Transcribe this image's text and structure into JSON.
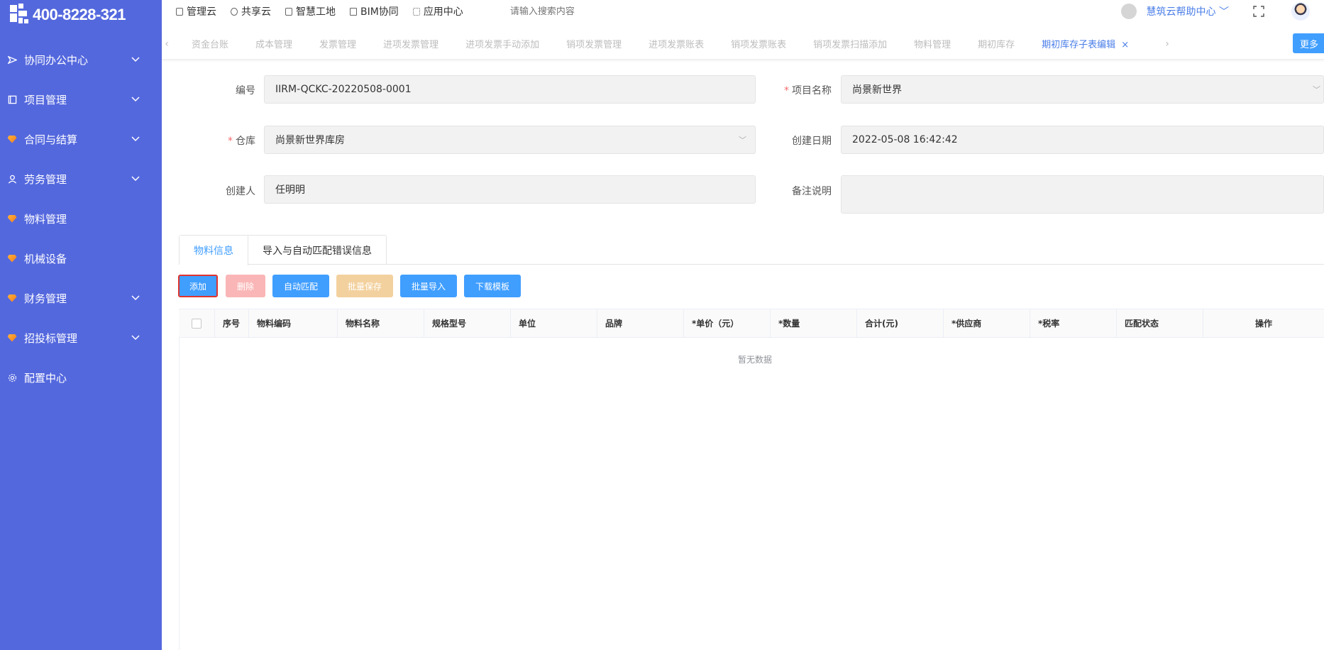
{
  "brand": {
    "phone": "400-8228-321"
  },
  "sidebar": {
    "items": [
      {
        "label": "协同办公中心",
        "icon": "send-icon",
        "chevron": true
      },
      {
        "label": "项目管理",
        "icon": "book-icon",
        "chevron": true
      },
      {
        "label": "合同与结算",
        "icon": "gem-icon",
        "chevron": true
      },
      {
        "label": "劳务管理",
        "icon": "user-icon",
        "chevron": true
      },
      {
        "label": "物料管理",
        "icon": "gem-icon",
        "chevron": false
      },
      {
        "label": "机械设备",
        "icon": "gem-icon",
        "chevron": false
      },
      {
        "label": "财务管理",
        "icon": "gem-icon",
        "chevron": true
      },
      {
        "label": "招投标管理",
        "icon": "gem-icon",
        "chevron": true
      },
      {
        "label": "配置中心",
        "icon": "gear-icon",
        "chevron": false
      }
    ]
  },
  "topbar": {
    "links": [
      "管理云",
      "共享云",
      "智慧工地",
      "BIM协同",
      "应用中心"
    ],
    "search_placeholder": "请输入搜索内容",
    "help": "慧筑云帮助中心"
  },
  "tabs": {
    "items": [
      "资金台账",
      "成本管理",
      "发票管理",
      "进项发票管理",
      "进项发票手动添加",
      "销项发票管理",
      "进项发票账表",
      "销项发票账表",
      "销项发票扫描添加",
      "物料管理",
      "期初库存"
    ],
    "active": "期初库存子表编辑",
    "more": "更多"
  },
  "form": {
    "code_label": "编号",
    "code_value": "IIRM-QCKC-20220508-0001",
    "project_label": "项目名称",
    "project_value": "尚景新世界",
    "warehouse_label": "仓库",
    "warehouse_value": "尚景新世界库房",
    "date_label": "创建日期",
    "date_value": "2022-05-08 16:42:42",
    "creator_label": "创建人",
    "creator_value": "任明明",
    "remark_label": "备注说明",
    "remark_value": ""
  },
  "subtabs": [
    "物料信息",
    "导入与自动匹配错误信息"
  ],
  "buttons": {
    "add": "添加",
    "delete": "删除",
    "auto_match": "自动匹配",
    "batch_save": "批量保存",
    "batch_import": "批量导入",
    "download": "下载模板"
  },
  "colors": {
    "primary": "#409eff",
    "danger_disabled": "#fab6b6",
    "warning_disabled": "#f3d19e",
    "sidebar": "#5468de",
    "highlight": "#e0332e"
  },
  "table": {
    "columns": [
      "序号",
      "物料编码",
      "物料名称",
      "规格型号",
      "单位",
      "品牌",
      "*单价（元）",
      "*数量",
      "合计(元)",
      "*供应商",
      "*税率",
      "匹配状态",
      "操作"
    ],
    "empty_text": "暂无数据"
  }
}
